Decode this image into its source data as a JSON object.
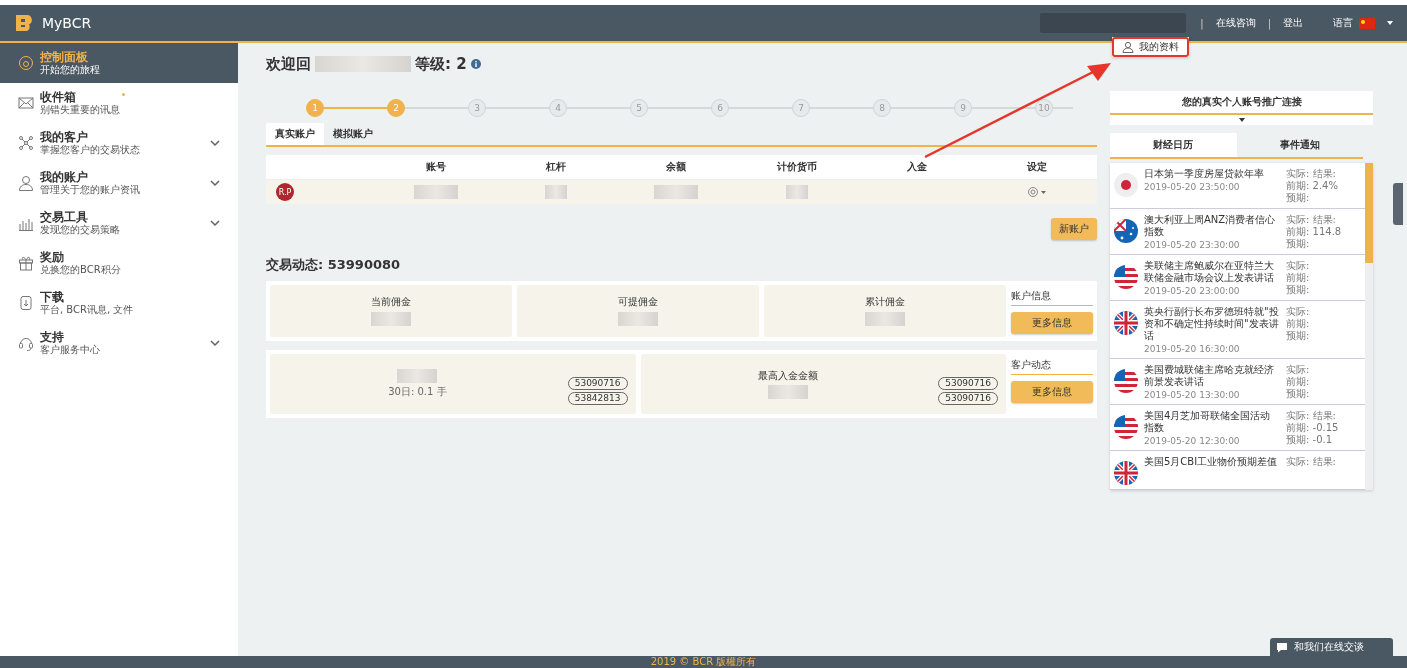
{
  "header": {
    "brand": "MyBCR",
    "links": [
      {
        "separator": "|",
        "label": "在线咨询"
      },
      {
        "separator": "|",
        "label": "登出"
      }
    ],
    "language": "语言",
    "user_menu": [
      {
        "label": "我的资料",
        "highlighted": true
      }
    ]
  },
  "sidebar": {
    "items": [
      {
        "kind": "gauge",
        "title": "控制面板",
        "subtitle": "开始您的旅程",
        "selected": true,
        "expandable": false,
        "dot": false
      },
      {
        "kind": "mail",
        "title": "收件箱",
        "subtitle": "别错失重要的讯息",
        "selected": false,
        "expandable": false,
        "dot": true
      },
      {
        "kind": "network",
        "title": "我的客户",
        "subtitle": "掌握您客户的交易状态",
        "selected": false,
        "expandable": true,
        "dot": false
      },
      {
        "kind": "user",
        "title": "我的账户",
        "subtitle": "管理关于您的账户资讯",
        "selected": false,
        "expandable": true,
        "dot": false
      },
      {
        "kind": "chart",
        "title": "交易工具",
        "subtitle": "发现您的交易策略",
        "selected": false,
        "expandable": true,
        "dot": false
      },
      {
        "kind": "gift",
        "title": "奖励",
        "subtitle": "兑换您的BCR积分",
        "selected": false,
        "expandable": false,
        "dot": false
      },
      {
        "kind": "download",
        "title": "下载",
        "subtitle": "平台, BCR讯息, 文件",
        "selected": false,
        "expandable": false,
        "dot": false
      },
      {
        "kind": "headset",
        "title": "支持",
        "subtitle": "客户服务中心",
        "selected": false,
        "expandable": true,
        "dot": false
      }
    ]
  },
  "welcome": {
    "greeting": "欢迎回",
    "level_label": "等级: 2"
  },
  "steps": [
    {
      "label": "1",
      "reached": true
    },
    {
      "label": "2",
      "reached": true
    },
    {
      "label": "3",
      "reached": false
    },
    {
      "label": "4",
      "reached": false
    },
    {
      "label": "5",
      "reached": false
    },
    {
      "label": "6",
      "reached": false
    },
    {
      "label": "7",
      "reached": false
    },
    {
      "label": "8",
      "reached": false
    },
    {
      "label": "9",
      "reached": false
    },
    {
      "label": "10",
      "reached": false
    }
  ],
  "account_tabs": [
    {
      "label": "真实账户",
      "selected": true
    },
    {
      "label": "模拟账户",
      "selected": false
    }
  ],
  "accounts_table": {
    "columns": [
      "账号",
      "杠杆",
      "余额",
      "计价货币",
      "入金",
      "设定"
    ],
    "rows": [
      {
        "badge": "R.P"
      }
    ]
  },
  "new_account_button": "新账户",
  "activity": {
    "title": "交易动态: 53990080",
    "row_1": {
      "cards": [
        {
          "label": "当前佣金"
        },
        {
          "label": "可提佣金"
        },
        {
          "label": "累计佣金"
        }
      ],
      "side_title": "账户信息",
      "button": "更多信息"
    },
    "row_2": {
      "cards": [
        {
          "note": "30日: 0.1 手",
          "tags": [
            "53090716",
            "53842813"
          ]
        },
        {
          "label": "最高入金金额",
          "tags": [
            "53090716",
            "53090716"
          ]
        }
      ],
      "side_title": "客户动态",
      "button": "更多信息"
    }
  },
  "referral": {
    "title": "您的真实个人账号推广连接"
  },
  "calendar_tabs": [
    {
      "label": "财经日历",
      "selected": true
    },
    {
      "label": "事件通知",
      "selected": false
    }
  ],
  "calendar": [
    {
      "kind": "japan",
      "title": "日本第一季度房屋贷款年率",
      "time": "2019-05-20 23:50:00",
      "stats": [
        "实际: 结果:",
        "前期: 2.4%",
        "预期:"
      ]
    },
    {
      "kind": "australia",
      "title": "澳大利亚上周ANZ消费者信心指数",
      "time": "2019-05-20 23:30:00",
      "stats": [
        "实际: 结果:",
        "前期: 114.8",
        "预期:"
      ]
    },
    {
      "kind": "usa",
      "title": "美联储主席鲍威尔在亚特兰大联储金融市场会议上发表讲话",
      "time": "2019-05-20 23:00:00",
      "stats": [
        "实际:",
        "前期:",
        "预期:"
      ]
    },
    {
      "kind": "uk",
      "title": "英央行副行长布罗德班特就\"投资和不确定性持续时间\"发表讲话",
      "time": "2019-05-20 16:30:00",
      "stats": [
        "实际:",
        "前期:",
        "预期:"
      ]
    },
    {
      "kind": "usa",
      "title": "美国费城联储主席哈克就经济前景发表讲话",
      "time": "2019-05-20 13:30:00",
      "stats": [
        "实际:",
        "前期:",
        "预期:"
      ]
    },
    {
      "kind": "usa",
      "title": "美国4月芝加哥联储全国活动指数",
      "time": "2019-05-20 12:30:00",
      "stats": [
        "实际: 结果:",
        "前期: -0.15",
        "预期: -0.1"
      ]
    },
    {
      "kind": "uk",
      "title": "美国5月CBI工业物价预期差值",
      "stats": [
        "实际: 结果:"
      ]
    }
  ],
  "footer": "2019 © BCR 版權所有",
  "chat_button": "和我们在线交谈"
}
